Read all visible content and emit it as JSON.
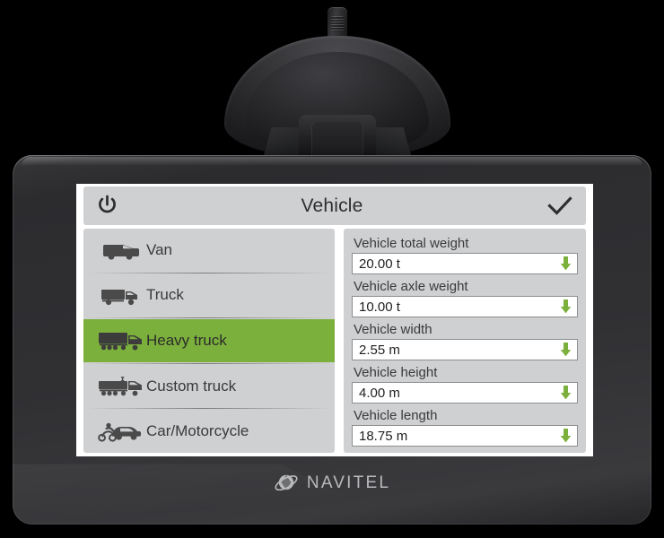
{
  "device": {
    "brand_name": "NAVITEL",
    "brand_logo_icon": "navitel-globe-icon",
    "mount_icon": "suction-cup-mount"
  },
  "screen": {
    "header": {
      "power_icon": "power-icon",
      "title": "Vehicle",
      "confirm_icon": "check-icon"
    },
    "vehicle_list": {
      "items": [
        {
          "label": "Van",
          "icon": "van-icon",
          "selected": false
        },
        {
          "label": "Truck",
          "icon": "truck-icon",
          "selected": false
        },
        {
          "label": "Heavy truck",
          "icon": "heavy-truck-icon",
          "selected": true
        },
        {
          "label": "Custom truck",
          "icon": "custom-truck-icon",
          "selected": false
        },
        {
          "label": "Car/Motorcycle",
          "icon": "car-motorcycle-icon",
          "selected": false
        }
      ]
    },
    "parameters": {
      "fields": [
        {
          "label": "Vehicle total weight",
          "value": "20.00 t",
          "arrow_icon": "down-arrow-icon"
        },
        {
          "label": "Vehicle axle weight",
          "value": "10.00 t",
          "arrow_icon": "down-arrow-icon"
        },
        {
          "label": "Vehicle width",
          "value": "2.55 m",
          "arrow_icon": "down-arrow-icon"
        },
        {
          "label": "Vehicle height",
          "value": "4.00 m",
          "arrow_icon": "down-arrow-icon"
        },
        {
          "label": "Vehicle length",
          "value": "18.75 m",
          "arrow_icon": "down-arrow-icon"
        }
      ]
    }
  },
  "colors": {
    "accent_green": "#7cb03c",
    "panel_gray": "#cfd0d2",
    "screen_white": "#ffffff",
    "text_dark": "#3a3a3a",
    "bezel_dark": "#303033"
  }
}
